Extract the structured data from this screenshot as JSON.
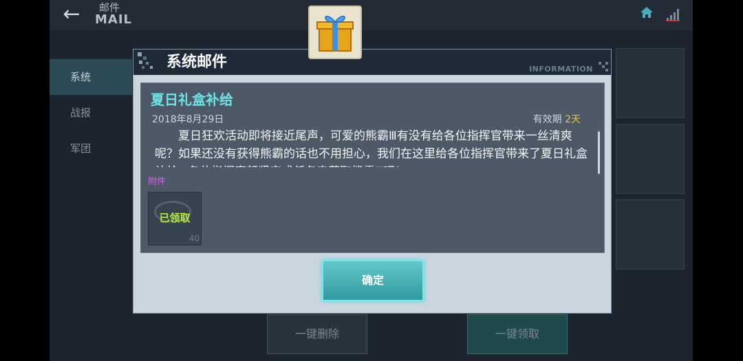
{
  "header": {
    "title_cn": "邮件",
    "title_en": "MAIL"
  },
  "sidebar": {
    "items": [
      {
        "label": "系统",
        "active": true
      },
      {
        "label": "战报",
        "active": false
      },
      {
        "label": "军团",
        "active": false
      }
    ]
  },
  "bottom": {
    "delete_label": "一键删除",
    "claim_label": "一键领取"
  },
  "dialog": {
    "title": "系统邮件",
    "info_text": "INFORMATION",
    "mail": {
      "subject": "夏日礼盒补给",
      "date": "2018年8月29日",
      "validity_label": "有效期",
      "validity_days": "2天",
      "body": "夏日狂欢活动即将接近尾声，可爱的熊霸Ⅲ有没有给各位指挥官带来一丝清爽呢？如果还没有获得熊霸的话也不用担心，我们在这里给各位指挥官带来了夏日礼盒补给~各位指挥官赶紧完成任务来获取熊霸Ⅲ吧！"
    },
    "attachment": {
      "label": "附件",
      "status": "已领取",
      "quantity": "40"
    },
    "confirm_label": "确定"
  },
  "colors": {
    "accent": "#6ee3e6",
    "validity": "#f0c23a",
    "attach_label": "#d564e0",
    "claimed": "#b8ef3a"
  },
  "icons": [
    "back-arrow-icon",
    "home-icon",
    "signal-icon",
    "gift-box-icon",
    "pixel-corner-icon"
  ]
}
